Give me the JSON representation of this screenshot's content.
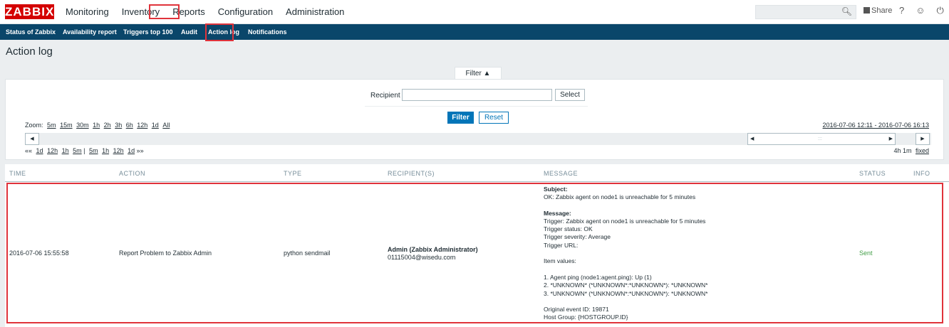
{
  "logo": "ZABBIX",
  "main_menu": [
    "Monitoring",
    "Inventory",
    "Reports",
    "Configuration",
    "Administration"
  ],
  "top_right": {
    "share": "Share",
    "help": "?",
    "user": "☺",
    "logout": "⏻"
  },
  "sub_menu": [
    "Status of Zabbix",
    "Availability report",
    "Triggers top 100",
    "Audit",
    "Action log",
    "Notifications"
  ],
  "page_title": "Action log",
  "filter": {
    "tab_label": "Filter ▲",
    "recipient_label": "Recipient",
    "recipient_value": "",
    "select_label": "Select",
    "filter_button": "Filter",
    "reset_button": "Reset"
  },
  "timeline": {
    "zoom_label": "Zoom:",
    "zoom_options": [
      "5m",
      "15m",
      "30m",
      "1h",
      "2h",
      "3h",
      "6h",
      "12h",
      "1d",
      "All"
    ],
    "period": "2016-07-06 12:11 - 2016-07-06 16:13",
    "nav_back_sym": "««",
    "nav_back": [
      "1d",
      "12h",
      "1h",
      "5m"
    ],
    "nav_sep": "|",
    "nav_fwd": [
      "5m",
      "1h",
      "12h",
      "1d"
    ],
    "nav_fwd_sym": "»»",
    "span": "4h 1m",
    "fixed": "fixed"
  },
  "table": {
    "headers": [
      "TIME",
      "ACTION",
      "TYPE",
      "RECIPIENT(S)",
      "MESSAGE",
      "STATUS",
      "INFO"
    ],
    "row": {
      "time": "2016-07-06 15:55:58",
      "action": "Report Problem to Zabbix Admin",
      "type": "python sendmail",
      "recipient_name": "Admin (Zabbix Administrator)",
      "recipient_email": "01115004@wisedu.com",
      "status": "Sent",
      "message": {
        "subject_label": "Subject:",
        "subject": "OK: Zabbix agent on node1 is unreachable for 5 minutes",
        "message_label": "Message:",
        "lines": [
          "Trigger: Zabbix agent on node1 is unreachable for 5 minutes",
          "Trigger status: OK",
          "Trigger severity: Average",
          "Trigger URL:",
          "",
          "Item values:",
          "",
          "1. Agent ping (node1:agent.ping): Up (1)",
          "2. *UNKNOWN* (*UNKNOWN*:*UNKNOWN*): *UNKNOWN*",
          "3. *UNKNOWN* (*UNKNOWN*:*UNKNOWN*): *UNKNOWN*",
          "",
          "Original event ID: 19871",
          "Host Group: {HOSTGROUP.ID}"
        ]
      }
    }
  },
  "colors": {
    "accent": "#0a466a",
    "logo": "#d40000",
    "highlight": "#e0333b",
    "status_ok": "#429e47",
    "button": "#0275b8"
  }
}
